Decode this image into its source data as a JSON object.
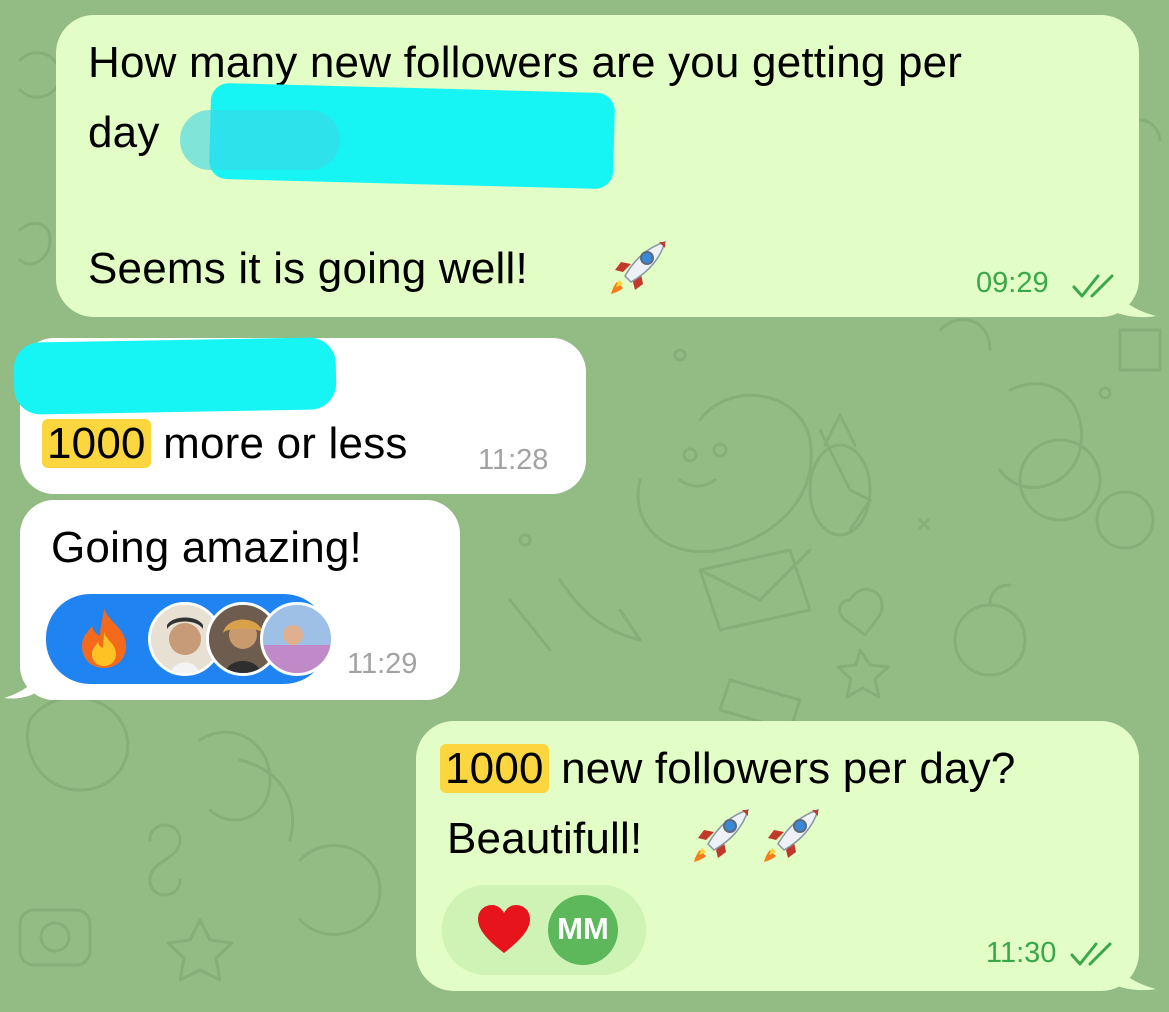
{
  "messages": [
    {
      "id": "m1",
      "direction": "outgoing",
      "line1": "How many new followers are you getting per",
      "line2_prefix": "day",
      "line2_suffix": "?",
      "line3_text": "Seems it is going well!",
      "line3_emoji": "rocket-emoji",
      "time": "09:29",
      "status": "read"
    },
    {
      "id": "m2",
      "direction": "incoming",
      "highlight": "1000",
      "text": "more or less",
      "time": "11:28"
    },
    {
      "id": "m3",
      "direction": "incoming",
      "text": "Going amazing!",
      "reaction_emoji": "fire-emoji",
      "time": "11:29"
    },
    {
      "id": "m4",
      "direction": "outgoing",
      "highlight": "1000",
      "line1_rest": "new followers per day?",
      "line2": "Beautifull!",
      "line2_emojis": [
        "rocket-emoji",
        "rocket-emoji"
      ],
      "reaction_emoji": "heart-emoji",
      "reaction_user_initials": "MM",
      "time": "11:30",
      "status": "read"
    }
  ],
  "colors": {
    "background": "#93bb84",
    "outgoing_bubble": "#e2fdc6",
    "incoming_bubble": "#ffffff",
    "outgoing_time": "#3aa84a",
    "incoming_time": "#a2a2a2",
    "highlight": "#fbd63e",
    "redaction": "#16f4f4",
    "reaction_blue": "#1f84f2",
    "avatar_mm": "#5cb85a"
  }
}
